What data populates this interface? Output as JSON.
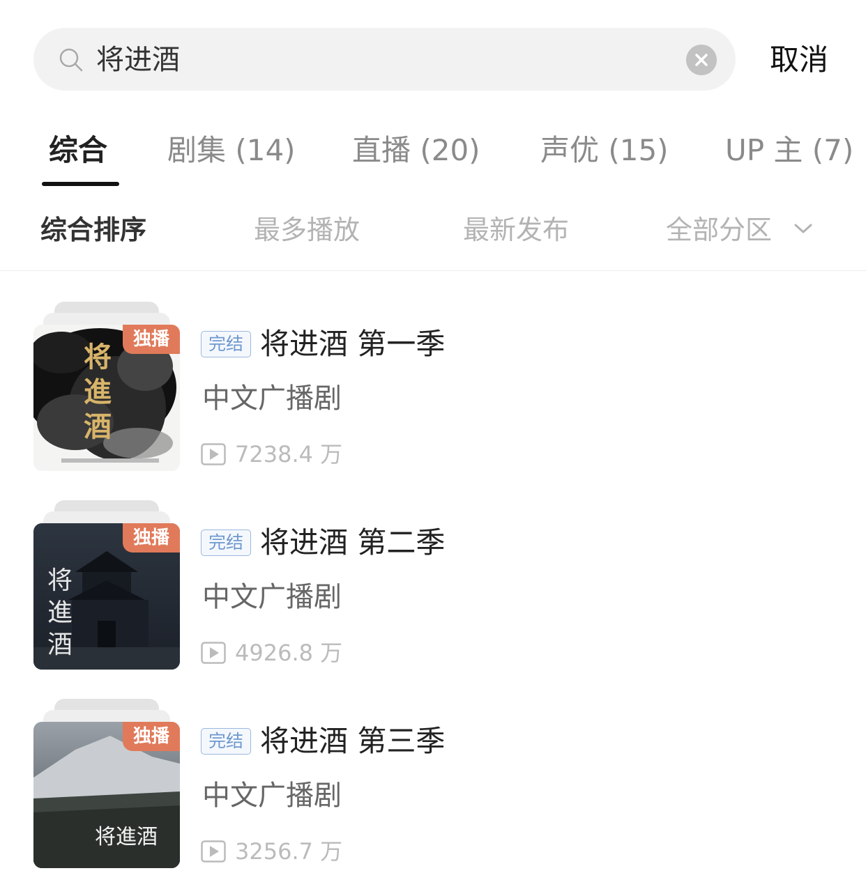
{
  "search": {
    "query": "将进酒",
    "cancel_label": "取消"
  },
  "tabs": [
    {
      "label": "综合"
    },
    {
      "label": "剧集 (14)"
    },
    {
      "label": "直播 (20)"
    },
    {
      "label": "声优 (15)"
    },
    {
      "label": "UP 主 (7)"
    }
  ],
  "sort": {
    "options": [
      "综合排序",
      "最多播放",
      "最新发布"
    ],
    "filter_label": "全部分区"
  },
  "results": [
    {
      "badge": "独播",
      "status": "完结",
      "title": "将进酒 第一季",
      "category": "中文广播剧",
      "plays": "7238.4 万",
      "cover_text": "将進酒"
    },
    {
      "badge": "独播",
      "status": "完结",
      "title": "将进酒 第二季",
      "category": "中文广播剧",
      "plays": "4926.8 万",
      "cover_text": "将進酒"
    },
    {
      "badge": "独播",
      "status": "完结",
      "title": "将进酒 第三季",
      "category": "中文广播剧",
      "plays": "3256.7 万",
      "cover_text": "将進酒"
    }
  ],
  "colors": {
    "badge": "#e07a5a",
    "status_border": "#9ab7de",
    "status_text": "#6f98cf"
  }
}
